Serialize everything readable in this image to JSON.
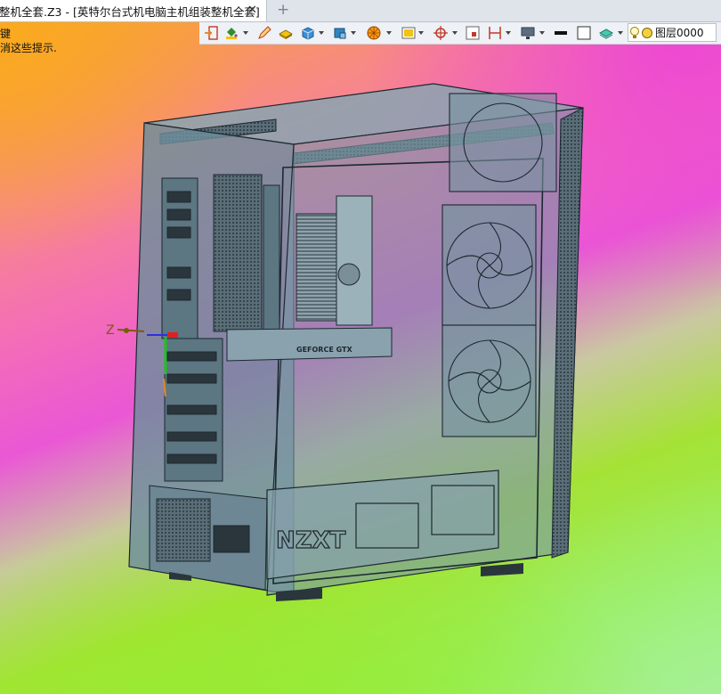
{
  "tab": {
    "title": "整机全套.Z3 - [英特尔台式机电脑主机组装整机全套]",
    "close_glyph": "✕",
    "add_glyph": "+"
  },
  "hints": {
    "line1": "键",
    "line2": "消这些提示."
  },
  "toolbar": {
    "icons": [
      "exit-icon",
      "paint-bucket-icon",
      "pen-icon",
      "solid-shade-icon",
      "box-view-icon",
      "box-style-icon",
      "wheel-icon",
      "image-frame-icon",
      "axis-origin-icon",
      "tag-frame-icon",
      "dimension-icon",
      "monitor-icon",
      "line-weight-icon",
      "color-swatch-icon",
      "layer-stack-icon"
    ],
    "layer_label": "图层0000"
  },
  "model": {
    "axis_label": "Z",
    "front_logo": "NZXT",
    "gpu_label": "GEFORCE GTX"
  },
  "colors": {
    "tab_bg": "#ffffff",
    "tabbar_bg": "#dfe4ea",
    "toolbar_bg": "#eef1f5",
    "case_fill": "#6e8e9c",
    "line": "#1d2830"
  }
}
